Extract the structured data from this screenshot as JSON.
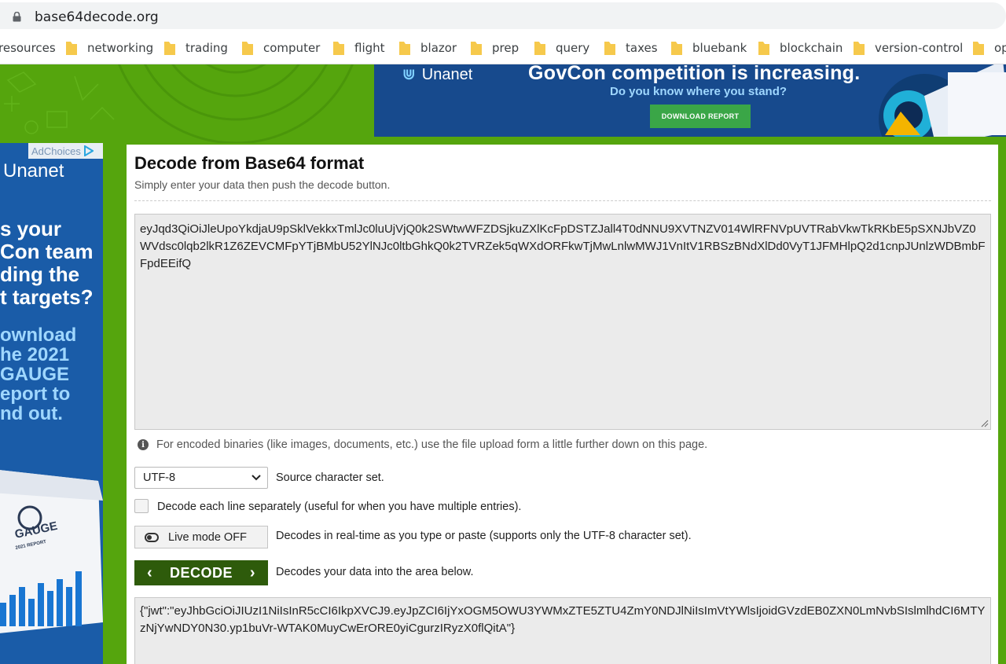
{
  "browser": {
    "url": "base64decode.org",
    "bookmarks": [
      "resources",
      "networking",
      "trading",
      "computer",
      "flight",
      "blazor",
      "prep",
      "query",
      "taxes",
      "bluebank",
      "blockchain",
      "version-control",
      "op"
    ]
  },
  "ads": {
    "top": {
      "brand": "Unanet",
      "headline": "GovCon competition is increasing.",
      "subline": "Do you know where you stand?",
      "cta": "DOWNLOAD REPORT"
    },
    "left": {
      "adchoices": "AdChoices",
      "brand": "Unanet",
      "question": "s your\nCon team\nding the\nt targets?",
      "cta": "ownload\nhe 2021\nGAUGE\neport to\nnd out.",
      "report_title": "GAUGE",
      "report_sub": "2021 REPORT"
    }
  },
  "main": {
    "title": "Decode from Base64 format",
    "subtitle": "Simply enter your data then push the decode button.",
    "input_value": "eyJqd3QiOiJleUpoYkdjaU9pSklVekkxTmlJc0luUjVjQ0k2SWtwWFZDSjkuZXlKcFpDSTZJall4T0dNNU9XVTNZV014WlRFNVpUVTRabVkwTkRKbE5pSXNJbVZ0WVdsc0lqb2lkR1Z6ZEVCMFpYTjBMbU52YlNJc0ltbGhkQ0k2TVRZek5qWXdORFkwTjMwLnlwMWJ1VnItV1RBSzBNdXlDd0VyT1JFMHlpQ2d1cnpJUnlzWDBmbFFpdEEifQ",
    "info_text": "For encoded binaries (like images, documents, etc.) use the file upload form a little further down on this page.",
    "charset_value": "UTF-8",
    "charset_label": "Source character set.",
    "separate_lines_label": "Decode each line separately (useful for when you have multiple entries).",
    "live_mode_button": "Live mode OFF",
    "live_mode_desc": "Decodes in real-time as you type or paste (supports only the UTF-8 character set).",
    "decode_button": "DECODE",
    "decode_desc": "Decodes your data into the area below.",
    "output_value": "{\"jwt\":\"eyJhbGciOiJIUzI1NiIsInR5cCI6IkpXVCJ9.eyJpZCI6IjYxOGM5OWU3YWMxZTE5ZTU4ZmY0NDJlNiIsImVtYWlsIjoidGVzdEB0ZXN0LmNvbSIslmlhdCI6MTYzNjYwNDY0N30.yp1buVr-WTAK0MuyCwErORE0yiCgurzIRyzX0flQitA\"}"
  },
  "colors": {
    "page_green": "#55a50d",
    "decode_button": "#2e5b0b",
    "ad_blue": "#1a5ca8"
  }
}
